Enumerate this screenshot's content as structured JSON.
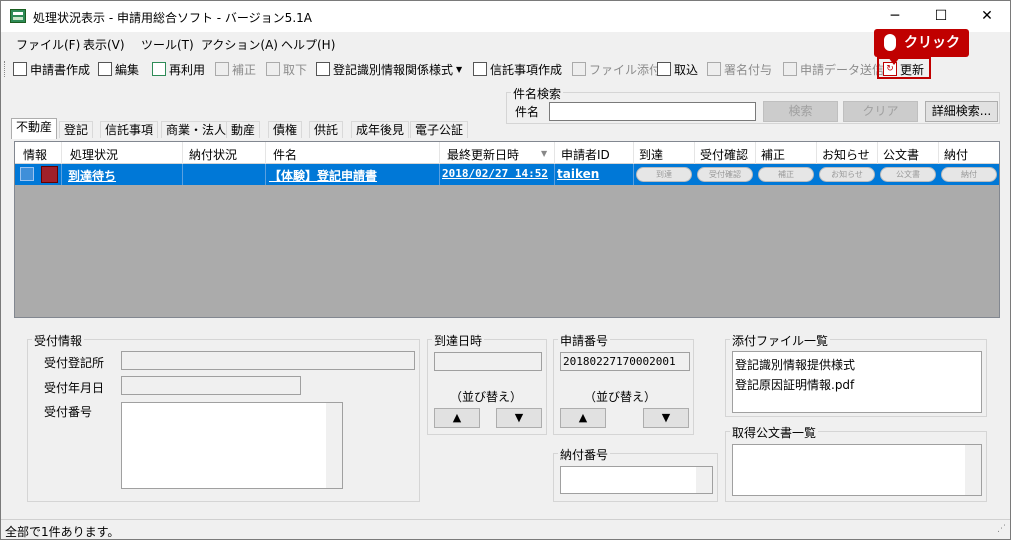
{
  "window": {
    "title": "処理状況表示 - 申請用総合ソフト - バージョン5.1A",
    "minimize": "─",
    "maximize": "☐",
    "close": "✕"
  },
  "menu": [
    "ファイル(F)",
    "表示(V)",
    "ツール(T)",
    "アクション(A)",
    "ヘルプ(H)"
  ],
  "toolbar": {
    "create": "申請書作成",
    "edit": "編集",
    "reuse": "再利用",
    "correct": "補正",
    "withdraw": "取下",
    "reg_info": "登記識別情報関係様式",
    "trust": "信託事項作成",
    "attach": "ファイル添付",
    "import": "取込",
    "sign": "署名付与",
    "send": "申請データ送信",
    "update": "更新"
  },
  "callout": {
    "label": "クリック"
  },
  "search": {
    "group": "件名検索",
    "label": "件名",
    "value": "",
    "search_btn": "検索",
    "clear_btn": "クリア",
    "detail_btn": "詳細検索..."
  },
  "tabs": [
    "不動産",
    "登記",
    "信託事項",
    "商業・法人",
    "動産",
    "債権",
    "供託",
    "成年後見",
    "電子公証"
  ],
  "grid": {
    "headers": [
      "情報",
      "処理状況",
      "納付状況",
      "件名",
      "最終更新日時",
      "申請者ID",
      "到達",
      "受付確認",
      "補正",
      "お知らせ",
      "公文書",
      "納付"
    ],
    "row": {
      "status": "到達待ち",
      "payment": "",
      "title": "【体験】登記申請書",
      "updated": "2018/02/27 14:52",
      "applicant": "taiken",
      "pills": [
        "到達",
        "受付確認",
        "補正",
        "お知らせ",
        "公文書",
        "納付"
      ]
    }
  },
  "receipt": {
    "group": "受付情報",
    "office_label": "受付登記所",
    "date_label": "受付年月日",
    "number_label": "受付番号"
  },
  "arrival": {
    "group": "到達日時",
    "sort_label": "（並び替え）",
    "up": "▲",
    "down": "▼"
  },
  "appno": {
    "group": "申請番号",
    "value": "20180227170002001",
    "sort_label": "（並び替え）",
    "up": "▲",
    "down": "▼"
  },
  "payno": {
    "group": "納付番号"
  },
  "attachments": {
    "group": "添付ファイル一覧",
    "items": [
      "登記識別情報提供様式",
      "登記原因証明情報.pdf"
    ]
  },
  "docs": {
    "group": "取得公文書一覧"
  },
  "status": {
    "text": "全部で1件あります。"
  }
}
